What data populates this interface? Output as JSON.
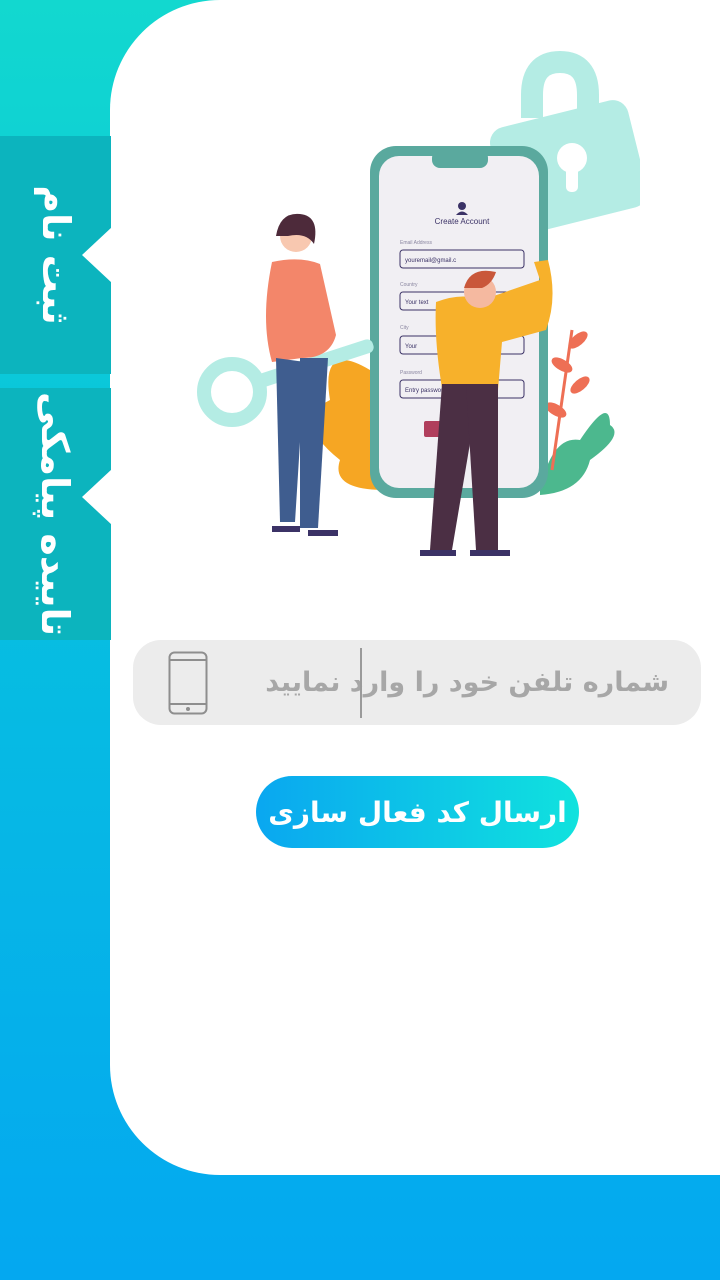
{
  "tabs": {
    "signup_label": "ثبت نام",
    "sms_label": "تاییده پیامکی"
  },
  "illustration": {
    "create_account_title": "Create Account",
    "email_label": "Email Address",
    "email_value": "youremail@gmail.c",
    "country_label": "Country",
    "country_value": "Your text",
    "city_label": "City",
    "city_value": "Your",
    "password_label": "Password",
    "password_value": "Entry password"
  },
  "phone_input": {
    "placeholder": "شماره تلفن خود را وارد نمایید",
    "icon": "smartphone-icon"
  },
  "send_button": {
    "label": "ارسال کد فعال سازی"
  },
  "colors": {
    "background_top": "#12d8cf",
    "background_bottom": "#04a8f0",
    "tab": "#0cb4be",
    "input_bg": "#ececec",
    "button_start": "#0aa7f0",
    "button_end": "#10e2de"
  }
}
